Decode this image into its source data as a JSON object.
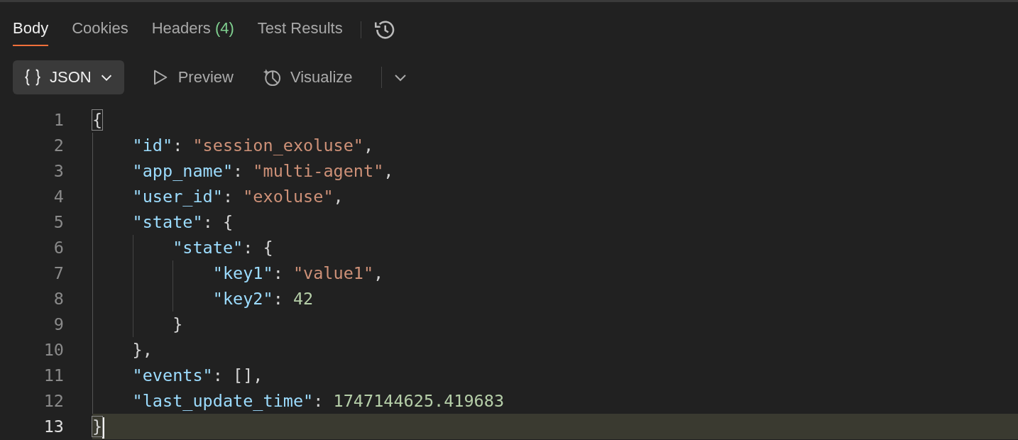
{
  "tabs": [
    {
      "label": "Body",
      "selected": true
    },
    {
      "label": "Cookies",
      "selected": false
    },
    {
      "label": "Headers",
      "count": "(4)",
      "selected": false
    },
    {
      "label": "Test Results",
      "selected": false
    }
  ],
  "toolbar": {
    "format": "JSON",
    "buttons": [
      {
        "label": "Preview",
        "kind": "preview"
      },
      {
        "label": "Visualize",
        "kind": "visualize"
      }
    ]
  },
  "editor": {
    "lines": [
      {
        "number": "1",
        "tokens": [
          {
            "kind": "brace",
            "text": "{",
            "matched": true
          }
        ],
        "current": false,
        "children": [
          {
            "number": "2",
            "tokens": [
              {
                "kind": "key",
                "text": "\"id\""
              },
              {
                "kind": "punct",
                "text": ": "
              },
              {
                "kind": "string",
                "text": "\"session_exoluse\""
              },
              {
                "kind": "punct",
                "text": ","
              }
            ],
            "current": false
          },
          {
            "number": "3",
            "tokens": [
              {
                "kind": "key",
                "text": "\"app_name\""
              },
              {
                "kind": "punct",
                "text": ": "
              },
              {
                "kind": "string",
                "text": "\"multi-agent\""
              },
              {
                "kind": "punct",
                "text": ","
              }
            ],
            "current": false
          },
          {
            "number": "4",
            "tokens": [
              {
                "kind": "key",
                "text": "\"user_id\""
              },
              {
                "kind": "punct",
                "text": ": "
              },
              {
                "kind": "string",
                "text": "\"exoluse\""
              },
              {
                "kind": "punct",
                "text": ","
              }
            ],
            "current": false
          },
          {
            "number": "5",
            "tokens": [
              {
                "kind": "key",
                "text": "\"state\""
              },
              {
                "kind": "punct",
                "text": ": {"
              }
            ],
            "current": false,
            "children": [
              {
                "number": "6",
                "tokens": [
                  {
                    "kind": "key",
                    "text": "\"state\""
                  },
                  {
                    "kind": "punct",
                    "text": ": {"
                  }
                ],
                "current": false,
                "children": [
                  {
                    "number": "7",
                    "tokens": [
                      {
                        "kind": "key",
                        "text": "\"key1\""
                      },
                      {
                        "kind": "punct",
                        "text": ": "
                      },
                      {
                        "kind": "string",
                        "text": "\"value1\""
                      },
                      {
                        "kind": "punct",
                        "text": ","
                      }
                    ],
                    "current": false
                  },
                  {
                    "number": "8",
                    "tokens": [
                      {
                        "kind": "key",
                        "text": "\"key2\""
                      },
                      {
                        "kind": "punct",
                        "text": ": "
                      },
                      {
                        "kind": "number",
                        "text": "42"
                      }
                    ],
                    "current": false
                  }
                ]
              },
              {
                "number": "9",
                "tokens": [
                  {
                    "kind": "punct",
                    "text": "}"
                  }
                ],
                "current": false
              }
            ]
          },
          {
            "number": "10",
            "tokens": [
              {
                "kind": "punct",
                "text": "},"
              }
            ],
            "current": false
          },
          {
            "number": "11",
            "tokens": [
              {
                "kind": "key",
                "text": "\"events\""
              },
              {
                "kind": "punct",
                "text": ": [],"
              }
            ],
            "current": false
          },
          {
            "number": "12",
            "tokens": [
              {
                "kind": "key",
                "text": "\"last_update_time\""
              },
              {
                "kind": "punct",
                "text": ": "
              },
              {
                "kind": "number",
                "text": "1747144625.419683"
              }
            ],
            "current": false
          }
        ]
      },
      {
        "number": "13",
        "tokens": [
          {
            "kind": "brace",
            "text": "}",
            "matched": true
          }
        ],
        "current": true
      }
    ]
  }
}
